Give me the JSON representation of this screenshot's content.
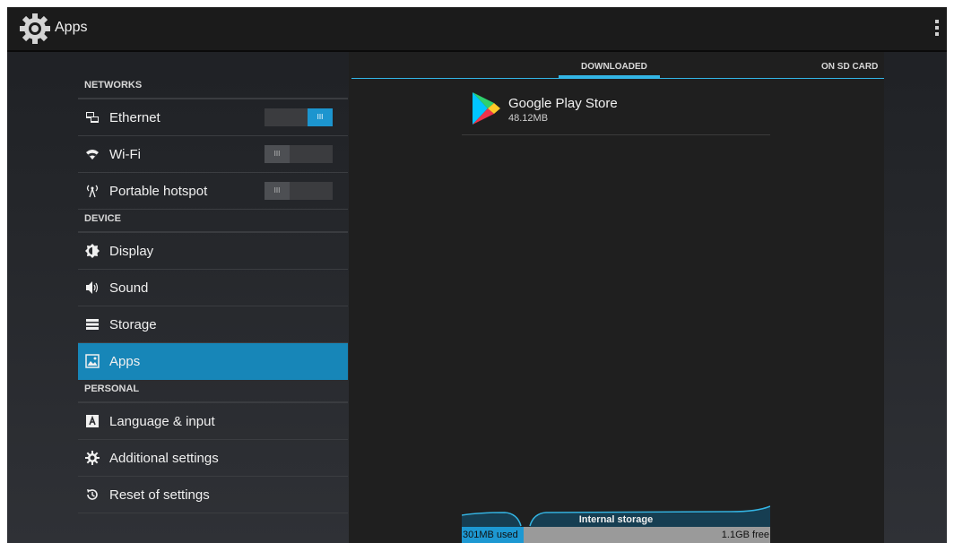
{
  "actionbar": {
    "title": "Apps",
    "icon": "settings-gear-icon",
    "overflow_icon": "overflow-menu-icon"
  },
  "sections": [
    {
      "title": "NETWORKS",
      "items": [
        {
          "label": "Ethernet",
          "icon": "ethernet-icon",
          "toggle": "on"
        },
        {
          "label": "Wi-Fi",
          "icon": "wifi-icon",
          "toggle": "off"
        },
        {
          "label": "Portable hotspot",
          "icon": "hotspot-icon",
          "toggle": "off"
        }
      ]
    },
    {
      "title": "DEVICE",
      "items": [
        {
          "label": "Display",
          "icon": "display-icon"
        },
        {
          "label": "Sound",
          "icon": "sound-icon"
        },
        {
          "label": "Storage",
          "icon": "storage-icon"
        },
        {
          "label": "Apps",
          "icon": "apps-icon",
          "selected": true
        }
      ]
    },
    {
      "title": "PERSONAL",
      "items": [
        {
          "label": "Language & input",
          "icon": "language-icon"
        },
        {
          "label": "Additional settings",
          "icon": "additional-settings-icon"
        },
        {
          "label": "Reset of settings",
          "icon": "reset-icon"
        }
      ]
    }
  ],
  "toggle_glyph": "III",
  "tabs": {
    "downloaded": "DOWNLOADED",
    "sd_card": "ON SD CARD",
    "selected": "DOWNLOADED"
  },
  "apps": [
    {
      "name": "Google Play Store",
      "size": "48.12MB",
      "icon": "play-store-icon"
    }
  ],
  "storage": {
    "label": "Internal storage",
    "used": "301MB used",
    "free": "1.1GB free",
    "used_fraction": 0.2
  },
  "colors": {
    "accent": "#33b5e5",
    "selected_bg": "#1786b8",
    "toggle_on": "#1c95cf"
  }
}
